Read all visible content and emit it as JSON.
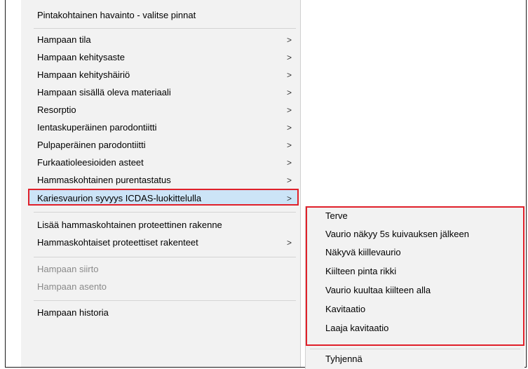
{
  "menu": {
    "header": "Pintakohtainen havainto - valitse pinnat",
    "groups": [
      [
        {
          "label": "Hampaan tila",
          "submenu": true
        },
        {
          "label": "Hampaan kehitysaste",
          "submenu": true
        },
        {
          "label": "Hampaan kehityshäiriö",
          "submenu": true
        },
        {
          "label": "Hampaan sisällä oleva materiaali",
          "submenu": true
        },
        {
          "label": "Resorptio",
          "submenu": true
        },
        {
          "label": "Ientaskuperäinen parodontiitti",
          "submenu": true
        },
        {
          "label": "Pulpaperäinen parodontiitti",
          "submenu": true
        },
        {
          "label": "Furkaatioleesioiden asteet",
          "submenu": true
        },
        {
          "label": "Hammaskohtainen purentastatus",
          "submenu": true
        },
        {
          "label": "Kariesvaurion syvyys ICDAS-luokittelulla",
          "submenu": true
        }
      ],
      [
        {
          "label": "Lisää hammaskohtainen proteettinen rakenne",
          "submenu": false
        },
        {
          "label": "Hammaskohtaiset proteettiset rakenteet",
          "submenu": true
        }
      ],
      [
        {
          "label": "Hampaan siirto",
          "submenu": false
        },
        {
          "label": "Hampaan asento",
          "submenu": false
        }
      ],
      [
        {
          "label": "Hampaan historia",
          "submenu": false
        }
      ]
    ],
    "arrow_glyph": ">"
  },
  "submenu": {
    "items": [
      "Terve",
      "Vaurio näkyy 5s kuivauksen jälkeen",
      "Näkyvä kiillevaurio",
      "Kiilteen pinta rikki",
      "Vaurio kuultaa kiilteen alla",
      "Kavitaatio",
      "Laaja kavitaatio"
    ],
    "clear": "Tyhjennä"
  },
  "colors": {
    "menu_bg": "#f2f2f2",
    "highlight_bg": "#cce4f7",
    "annotation_red": "#e0202a",
    "disabled_text": "#8a8a8a"
  }
}
